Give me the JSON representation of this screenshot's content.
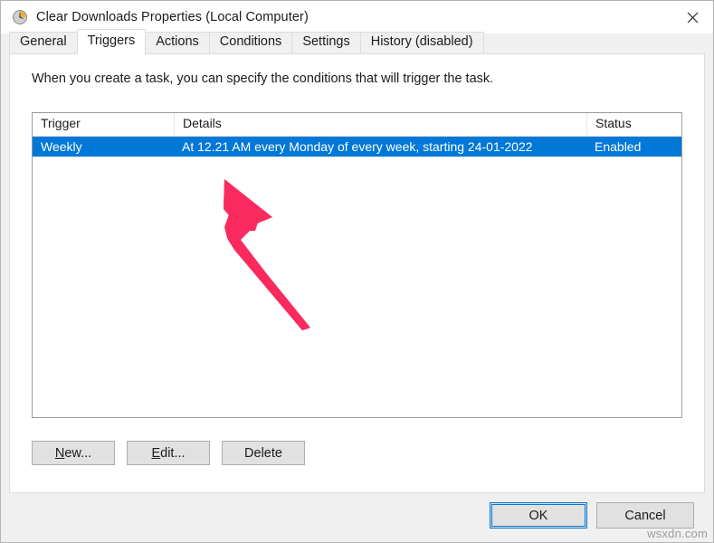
{
  "window": {
    "title": "Clear Downloads Properties (Local Computer)",
    "icon": "clock-icon",
    "close_label": "×"
  },
  "tabs": [
    {
      "label": "General",
      "active": false
    },
    {
      "label": "Triggers",
      "active": true
    },
    {
      "label": "Actions",
      "active": false
    },
    {
      "label": "Conditions",
      "active": false
    },
    {
      "label": "Settings",
      "active": false
    },
    {
      "label": "History (disabled)",
      "active": false
    }
  ],
  "panel": {
    "description": "When you create a task, you can specify the conditions that will trigger the task."
  },
  "list": {
    "columns": [
      {
        "label": "Trigger"
      },
      {
        "label": "Details"
      },
      {
        "label": "Status"
      }
    ],
    "rows": [
      {
        "trigger": "Weekly",
        "details": "At 12.21 AM every Monday of every week, starting 24-01-2022",
        "status": "Enabled",
        "selected": true
      }
    ]
  },
  "action_buttons": [
    {
      "accel": "N",
      "rest": "ew...",
      "name": "new-button"
    },
    {
      "accel": "E",
      "rest": "dit...",
      "name": "edit-button"
    },
    {
      "accel": "",
      "rest": "Delete",
      "name": "delete-button"
    }
  ],
  "footer": {
    "ok_label": "OK",
    "cancel_label": "Cancel"
  },
  "watermark": {
    "text": "wsxdn.com"
  },
  "annotation": {
    "type": "arrow",
    "color": "#fa2a5e",
    "points_to": "trigger-details-cell"
  },
  "colors": {
    "selection": "#0078d7",
    "dialog_background": "#f0f0f0",
    "panel_background": "#ffffff",
    "accent": "#0078d7",
    "annotation": "#fa2a5e"
  }
}
